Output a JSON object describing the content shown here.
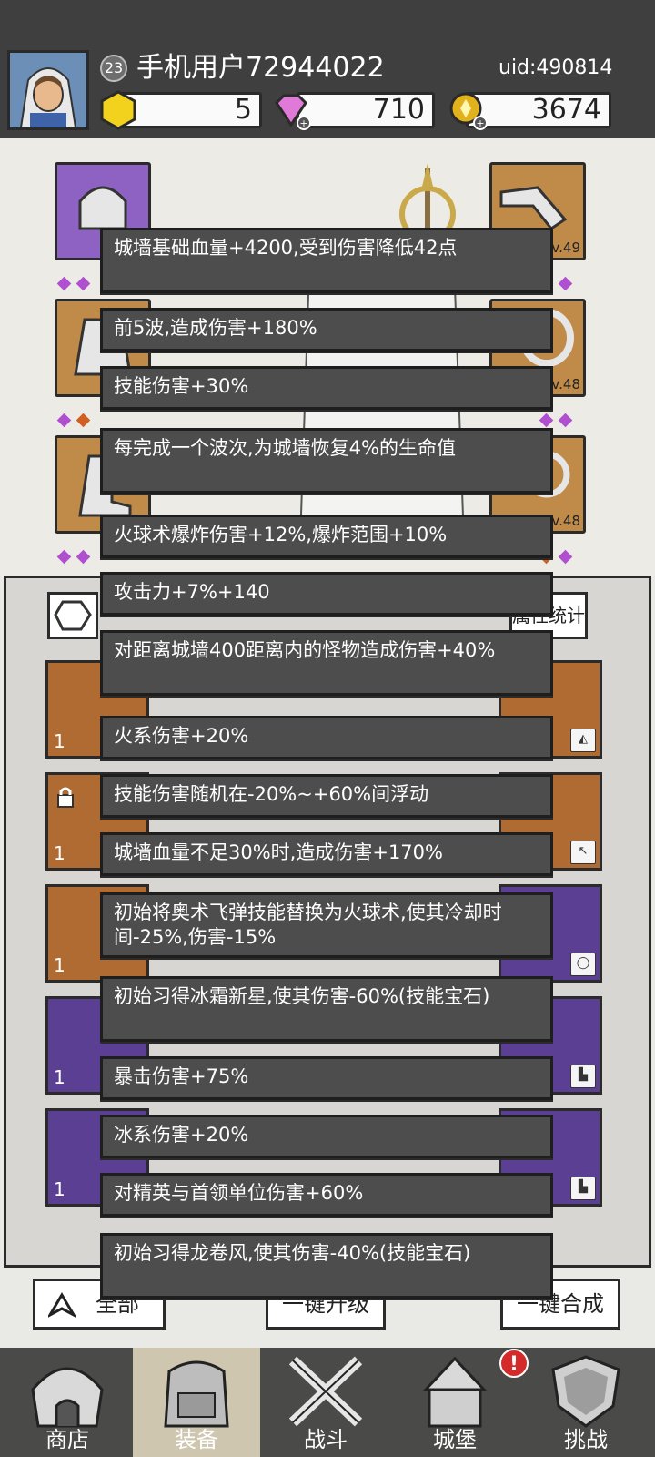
{
  "header": {
    "level": "23",
    "username": "手机用户72944022",
    "uid": "uid:490814",
    "resources": [
      {
        "name": "gold-hex",
        "value": "5"
      },
      {
        "name": "diamond",
        "value": "710"
      },
      {
        "name": "coin",
        "value": "3674"
      }
    ]
  },
  "equipment": {
    "right_levels": [
      "v.49",
      "v.48",
      "v.48"
    ]
  },
  "inventory": {
    "stats_label": "属性统计",
    "card_count": "1"
  },
  "buttons": {
    "all": "全部",
    "upgrade": "一键升级",
    "merge": "一键合成"
  },
  "nav": [
    {
      "label": "商店"
    },
    {
      "label": "装备"
    },
    {
      "label": "战斗"
    },
    {
      "label": "城堡"
    },
    {
      "label": "挑战"
    }
  ],
  "tooltips": [
    "城墙基础血量+4200,受到伤害降低42点",
    "前5波,造成伤害+180%",
    "技能伤害+30%",
    "每完成一个波次,为城墙恢复4%的生命值",
    "火球术爆炸伤害+12%,爆炸范围+10%",
    "攻击力+7%+140",
    "对距离城墙400距离内的怪物造成伤害+40%",
    "火系伤害+20%",
    "技能伤害随机在-20%~+60%间浮动",
    "城墙血量不足30%时,造成伤害+170%",
    "初始将奥术飞弹技能替换为火球术,使其冷却时间-25%,伤害-15%",
    "初始习得冰霜新星,使其伤害-60%(技能宝石)",
    "暴击伤害+75%",
    "冰系伤害+20%",
    "对精英与首领单位伤害+60%",
    "初始习得龙卷风,使其伤害-40%(技能宝石)"
  ],
  "colors": {
    "header_bg": "#3f3f3f",
    "tooltip_bg": "#4d4d4d",
    "purple_slot": "#8e62c3",
    "orange_slot": "#c08a48"
  }
}
